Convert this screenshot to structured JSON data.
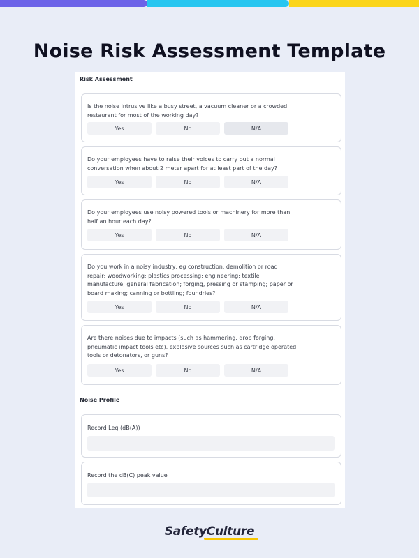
{
  "colors": {
    "stripe_purple": "#6c63e8",
    "stripe_cyan": "#27c6f0",
    "stripe_yellow": "#fbd51a",
    "page_background": "#e9edf7",
    "brand_underline": "#f7c600"
  },
  "title": "Noise Risk Assessment Template",
  "risk_assessment": {
    "heading": "Risk Assessment",
    "questions": [
      {
        "text": "Is the noise intrusive like a busy street, a vacuum cleaner or a crowded restaurant for most of the working day?",
        "options": [
          "Yes",
          "No",
          "N/A"
        ],
        "selected": "N/A"
      },
      {
        "text": "Do your employees have to raise their voices to carry out a normal conversation when about 2 meter apart for at least part of the day?",
        "options": [
          "Yes",
          "No",
          "N/A"
        ]
      },
      {
        "text": "Do your employees use noisy powered tools or machinery for more than half an hour each day?",
        "options": [
          "Yes",
          "No",
          "N/A"
        ]
      },
      {
        "text": "Do you work in a noisy industry, eg construction, demolition or road repair; woodworking; plastics processing; engineering; textile manufacture; general fabrication; forging, pressing or stamping; paper or board making; canning or bottling; foundries?",
        "options": [
          "Yes",
          "No",
          "N/A"
        ]
      },
      {
        "text": "Are there noises due to impacts (such as hammering, drop forging, pneumatic impact tools etc), explosive sources such as cartridge operated tools or detonators, or guns?",
        "options": [
          "Yes",
          "No",
          "N/A"
        ]
      }
    ]
  },
  "noise_profile": {
    "heading": "Noise Profile",
    "fields": [
      {
        "label": "Record Leq (dB(A))",
        "value": ""
      },
      {
        "label": "Record the dB(C) peak value",
        "value": ""
      }
    ]
  },
  "brand": {
    "name": "SafetyCulture"
  }
}
